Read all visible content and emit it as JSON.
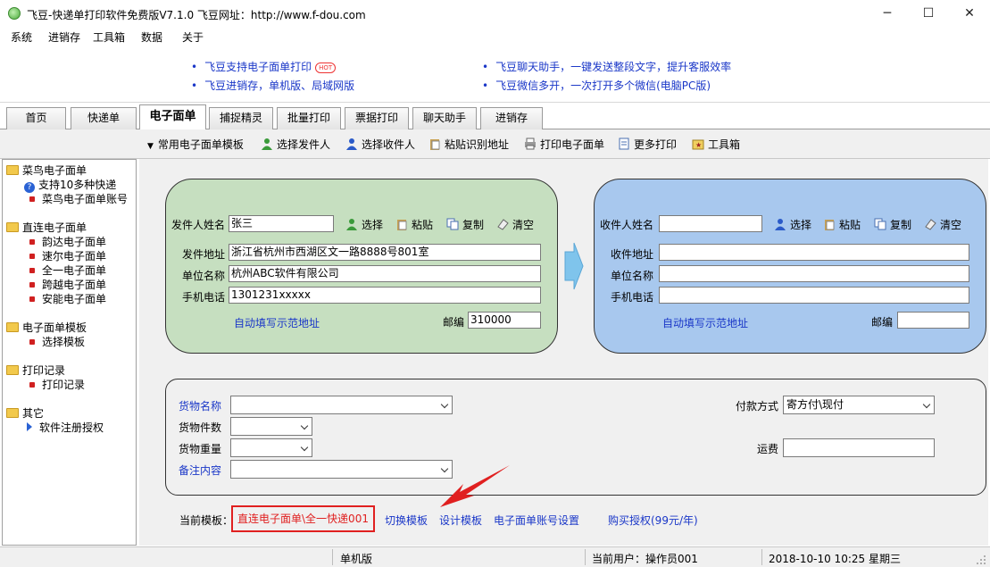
{
  "window": {
    "title": "飞豆-快递单打印软件免费版V7.1.0  飞豆网址：http://www.f-dou.com",
    "minimize": "─",
    "maximize": "☐",
    "close": "✕"
  },
  "menu": [
    "系统",
    "进销存",
    "工具箱",
    "数据",
    "关于"
  ],
  "banner": {
    "left": [
      "飞豆支持电子面单打印",
      "飞豆进销存，单机版、局域网版"
    ],
    "hot_badge": "HOT",
    "right": [
      "飞豆聊天助手，一键发送整段文字，提升客服效率",
      "飞豆微信多开，一次打开多个微信(电脑PC版)"
    ]
  },
  "tabs": [
    "首页",
    "快递单",
    "电子面单",
    "捕捉精灵",
    "批量打印",
    "票据打印",
    "聊天助手",
    "进销存"
  ],
  "active_tab": "电子面单",
  "toolbar": [
    "常用电子面单模板",
    "选择发件人",
    "选择收件人",
    "粘贴识别地址",
    "打印电子面单",
    "更多打印",
    "工具箱"
  ],
  "sidebar": {
    "groups": [
      {
        "label": "菜鸟电子面单",
        "items": [
          "支持10多种快递",
          "菜鸟电子面单账号"
        ]
      },
      {
        "label": "直连电子面单",
        "items": [
          "韵达电子面单",
          "速尔电子面单",
          "全一电子面单",
          "跨越电子面单",
          "安能电子面单"
        ]
      },
      {
        "label": "电子面单模板",
        "items": [
          "选择模板"
        ]
      },
      {
        "label": "打印记录",
        "items": [
          "打印记录"
        ]
      },
      {
        "label": "其它",
        "items": [
          "软件注册授权"
        ]
      }
    ]
  },
  "sender": {
    "name_label": "发件人姓名",
    "name_value": "张三",
    "address_label": "发件地址",
    "address_value": "浙江省杭州市西湖区文一路8888号801室",
    "company_label": "单位名称",
    "company_value": "杭州ABC软件有限公司",
    "phone_label": "手机电话",
    "phone_value": "1301231xxxxx",
    "autofill_link": "自动填写示范地址",
    "zip_label": "邮编",
    "zip_value": "310000",
    "actions": [
      "选择",
      "粘贴",
      "复制",
      "清空"
    ]
  },
  "receiver": {
    "name_label": "收件人姓名",
    "name_value": "",
    "address_label": "收件地址",
    "address_value": "",
    "company_label": "单位名称",
    "company_value": "",
    "phone_label": "手机电话",
    "phone_value": "",
    "autofill_link": "自动填写示范地址",
    "zip_label": "邮编",
    "zip_value": "",
    "actions": [
      "选择",
      "粘贴",
      "复制",
      "清空"
    ]
  },
  "goods": {
    "name_label": "货物名称",
    "count_label": "货物件数",
    "weight_label": "货物重量",
    "remark_label": "备注内容",
    "payment_label": "付款方式",
    "payment_value": "寄方付\\现付",
    "freight_label": "运费"
  },
  "bottom": {
    "current_template_label": "当前模板：",
    "current_template_value": "直连电子面单\\全一快递001",
    "links": [
      "切换模板",
      "设计模板",
      "电子面单账号设置",
      "购买授权(99元/年)"
    ]
  },
  "status": {
    "mode": "单机版",
    "user": "当前用户：操作员001",
    "datetime": "2018-10-10 10:25 星期三"
  },
  "colors": {
    "sender_card": "#c6dfc0",
    "receiver_card": "#a8c8ee",
    "link": "#1a37c8",
    "highlight_red": "#e02020"
  }
}
